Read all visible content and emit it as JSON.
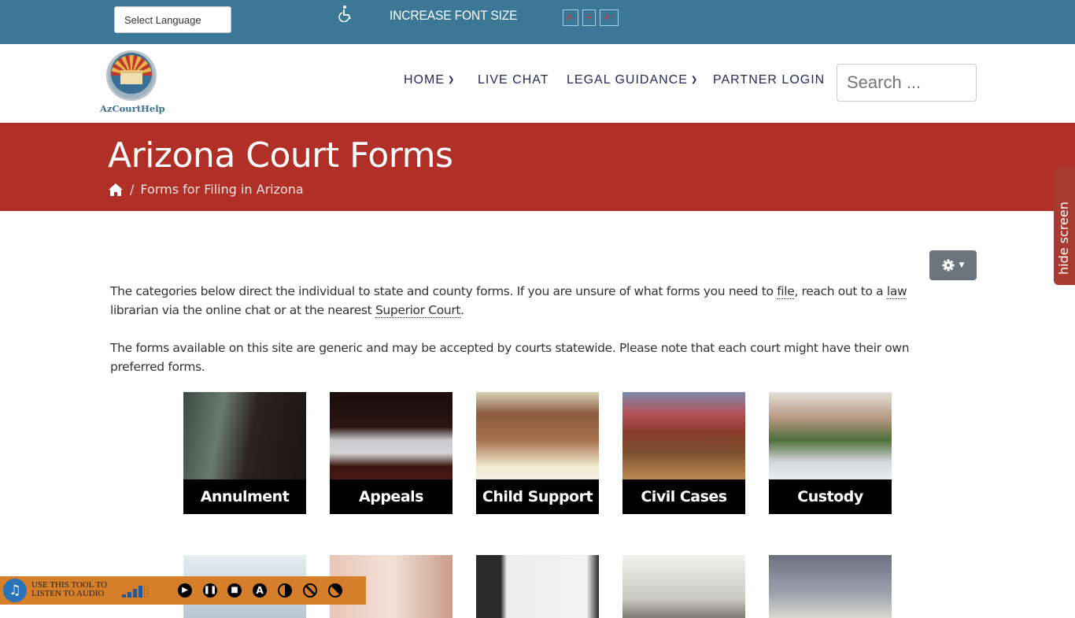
{
  "topbar": {
    "language_select": "Select Language",
    "accessibility_icon": "wheelchair-icon",
    "font_size_label": "INCREASE FONT SIZE",
    "font_buttons": [
      "A-",
      "A",
      "A+"
    ]
  },
  "header": {
    "logo_text": "AzCourtHelp",
    "nav": [
      {
        "label": "HOME",
        "has_dropdown": true
      },
      {
        "label": "LIVE CHAT",
        "has_dropdown": false
      },
      {
        "label": "LEGAL GUIDANCE",
        "has_dropdown": true
      },
      {
        "label": "PARTNER LOGIN",
        "has_dropdown": false
      }
    ],
    "search_placeholder": "Search ..."
  },
  "hero": {
    "title": "Arizona Court Forms",
    "breadcrumb_separator": "/",
    "breadcrumb_current": "Forms for Filing in Arizona",
    "color": "#b03028"
  },
  "side_tab": {
    "label": "hide screen"
  },
  "tools_button": {
    "icon": "gear-icon"
  },
  "intro": {
    "p1_a": "The categories below direct the individual to state and county forms.  If you are unsure of what forms you need to ",
    "p1_file": "file",
    "p1_b": ", reach out to a ",
    "p1_law": "law",
    "p1_c": " librarian via the online chat or at the nearest ",
    "p1_court": "Superior Court",
    "p1_d": ".",
    "p2": "The forms available on this site are generic and may be accepted by courts statewide. Please note that each court might have their own preferred forms."
  },
  "categories": [
    {
      "label": "Annulment"
    },
    {
      "label": "Appeals"
    },
    {
      "label": "Child Support"
    },
    {
      "label": "Civil Cases"
    },
    {
      "label": "Custody"
    }
  ],
  "categories_row2_images": [
    "handcuffs-photo",
    "woman-photo",
    "eviction-notice-photo",
    "money-laptop-photo",
    "money-exchange-photo"
  ],
  "audio_tool": {
    "line1": "USE THIS TOOL TO",
    "line2": "LISTEN TO AUDIO",
    "controls": [
      "play",
      "pause",
      "stop",
      "A",
      "contrast",
      "contrast-2",
      "contrast-3"
    ]
  }
}
